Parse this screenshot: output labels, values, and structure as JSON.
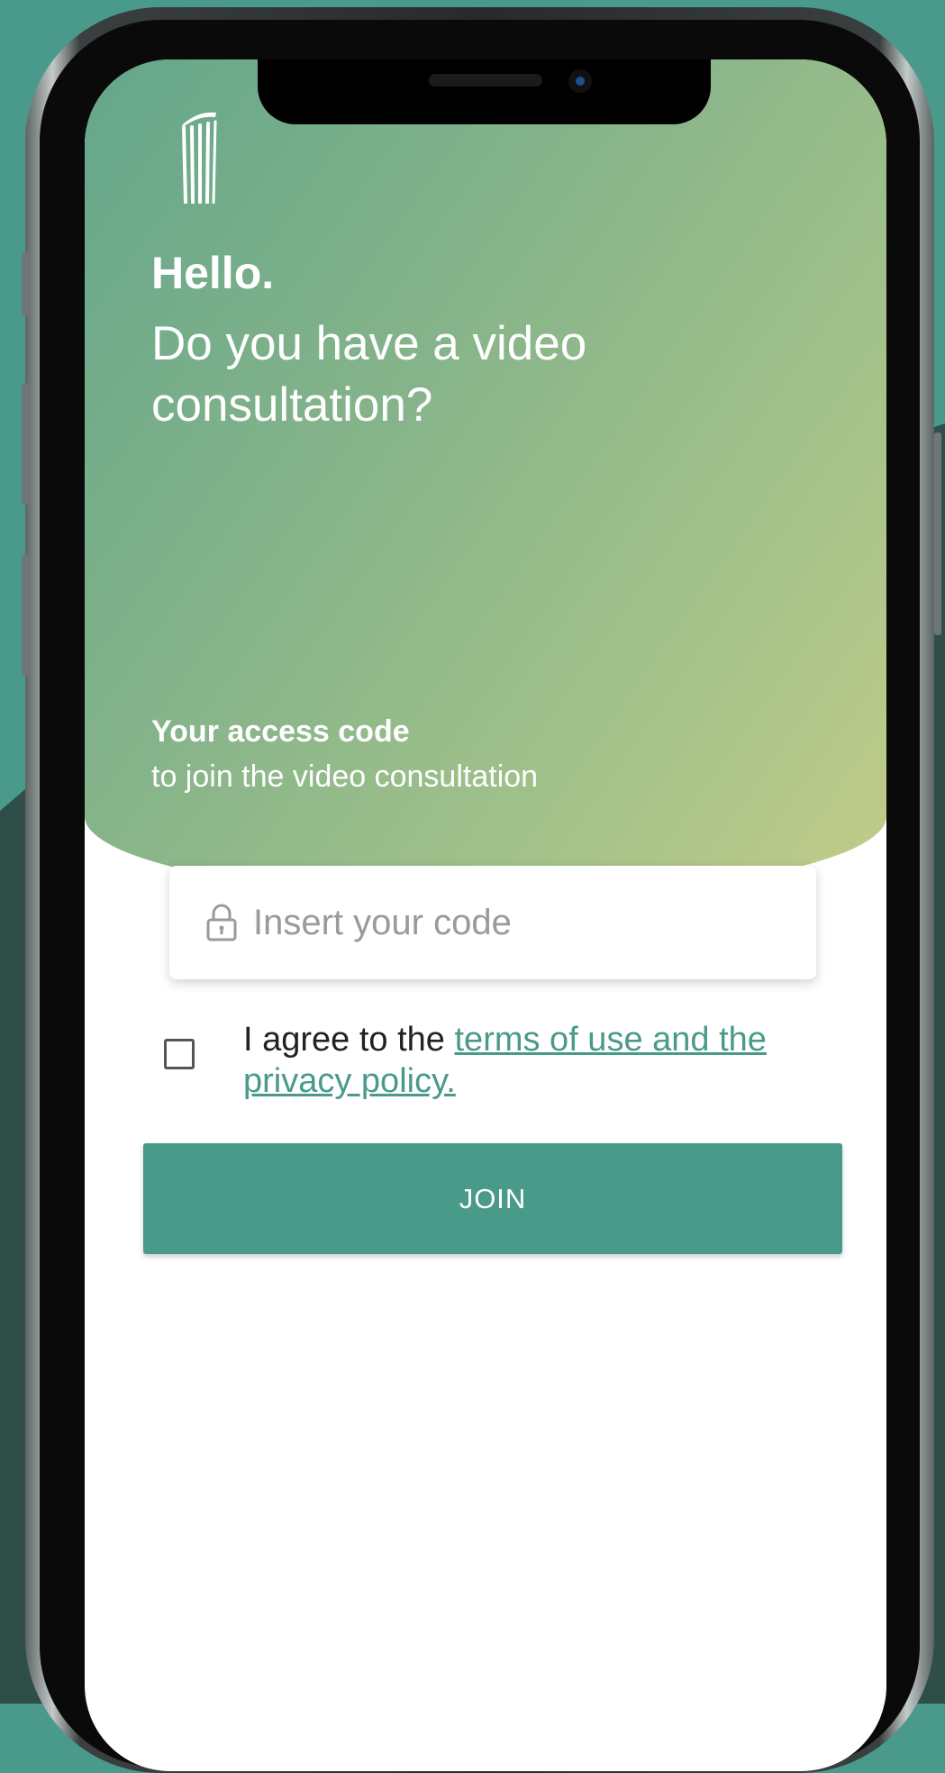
{
  "colors": {
    "background": "#4a9a8c",
    "hero_gradient_start": "#64a68b",
    "hero_gradient_end": "#c2cc89",
    "accent": "#4a9a8a"
  },
  "header": {
    "logo_icon": "column-logo-icon",
    "greeting": "Hello.",
    "question": "Do you have a video consultation?"
  },
  "access": {
    "title": "Your access code",
    "subtitle": "to join the video consultation"
  },
  "code_field": {
    "icon": "lock-icon",
    "placeholder": "Insert your code",
    "value": ""
  },
  "agreement": {
    "checked": false,
    "prefix": "I agree to the ",
    "link_text": "terms of use and the privacy policy."
  },
  "join_button": {
    "label": "JOIN"
  }
}
